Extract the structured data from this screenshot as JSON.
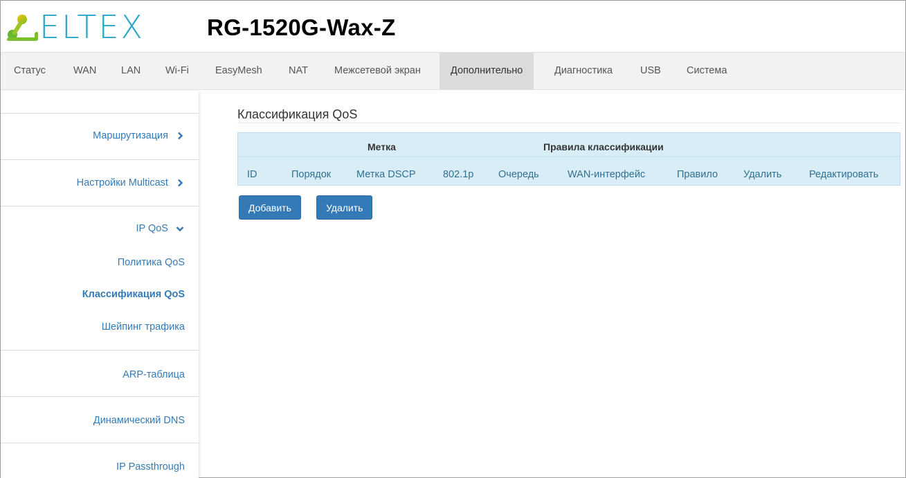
{
  "brand": {
    "logo_text": "ELTEX",
    "model": "RG-1520G-Wax-Z",
    "color": "#2aa7c6"
  },
  "topnav": {
    "items": [
      {
        "label": "Статус"
      },
      {
        "label": "WAN"
      },
      {
        "label": "LAN"
      },
      {
        "label": "Wi-Fi"
      },
      {
        "label": "EasyMesh"
      },
      {
        "label": "NAT"
      },
      {
        "label": "Межсетевой экран"
      },
      {
        "label": "Дополнительно",
        "active": true
      },
      {
        "label": "Диагностика"
      },
      {
        "label": "USB"
      },
      {
        "label": "Система"
      }
    ]
  },
  "sidebar": {
    "items": [
      {
        "label": "Маршрутизация",
        "icon": "chevron-right-icon"
      },
      {
        "label": "Настройки Multicast",
        "icon": "chevron-right-icon"
      },
      {
        "label": "IP QoS",
        "icon": "chevron-down-icon"
      },
      {
        "label": "Политика QoS"
      },
      {
        "label": "Классификация QoS",
        "active": true
      },
      {
        "label": "Шейпинг трафика"
      },
      {
        "label": "ARP-таблица"
      },
      {
        "label": "Динамический DNS"
      },
      {
        "label": "IP Passthrough"
      }
    ]
  },
  "main": {
    "title": "Классификация QoS",
    "table": {
      "group_headers": [
        "Метка",
        "Правила классификации"
      ],
      "columns": [
        "ID",
        "Порядок",
        "Метка DSCP",
        "802.1p",
        "Очередь",
        "WAN-интерфейс",
        "Правило",
        "Удалить",
        "Редактировать"
      ],
      "rows": []
    },
    "buttons": {
      "add": "Добавить",
      "delete": "Удалить"
    }
  },
  "colors": {
    "link": "#337ab7",
    "table_bg": "#d9edf7",
    "button_bg": "#337ab7",
    "nav_bg": "#f2f2f2",
    "nav_active_bg": "#dcdcdc"
  }
}
